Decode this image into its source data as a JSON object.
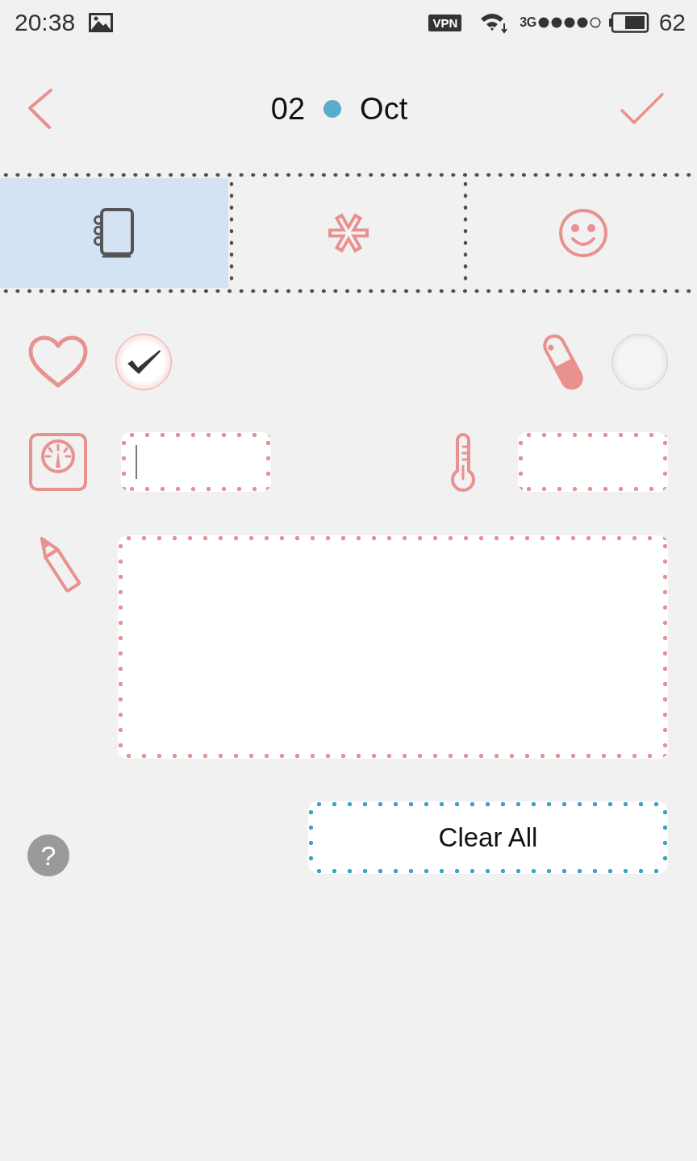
{
  "status_bar": {
    "time": "20:38",
    "vpn": "VPN",
    "network": "3G",
    "battery": "62"
  },
  "header": {
    "day": "02",
    "month": "Oct"
  },
  "tabs": [
    {
      "kind": "notebook",
      "selected": true
    },
    {
      "kind": "asterisk",
      "selected": false
    },
    {
      "kind": "smiley",
      "selected": false
    }
  ],
  "toggles": [
    {
      "kind": "heart",
      "checked": true
    },
    {
      "kind": "pill",
      "checked": false
    }
  ],
  "fields": [
    {
      "kind": "weight",
      "focused": true
    },
    {
      "kind": "temperature",
      "focused": false
    }
  ],
  "clear_button": {
    "label": "Clear All"
  },
  "help": {
    "label": "?"
  }
}
